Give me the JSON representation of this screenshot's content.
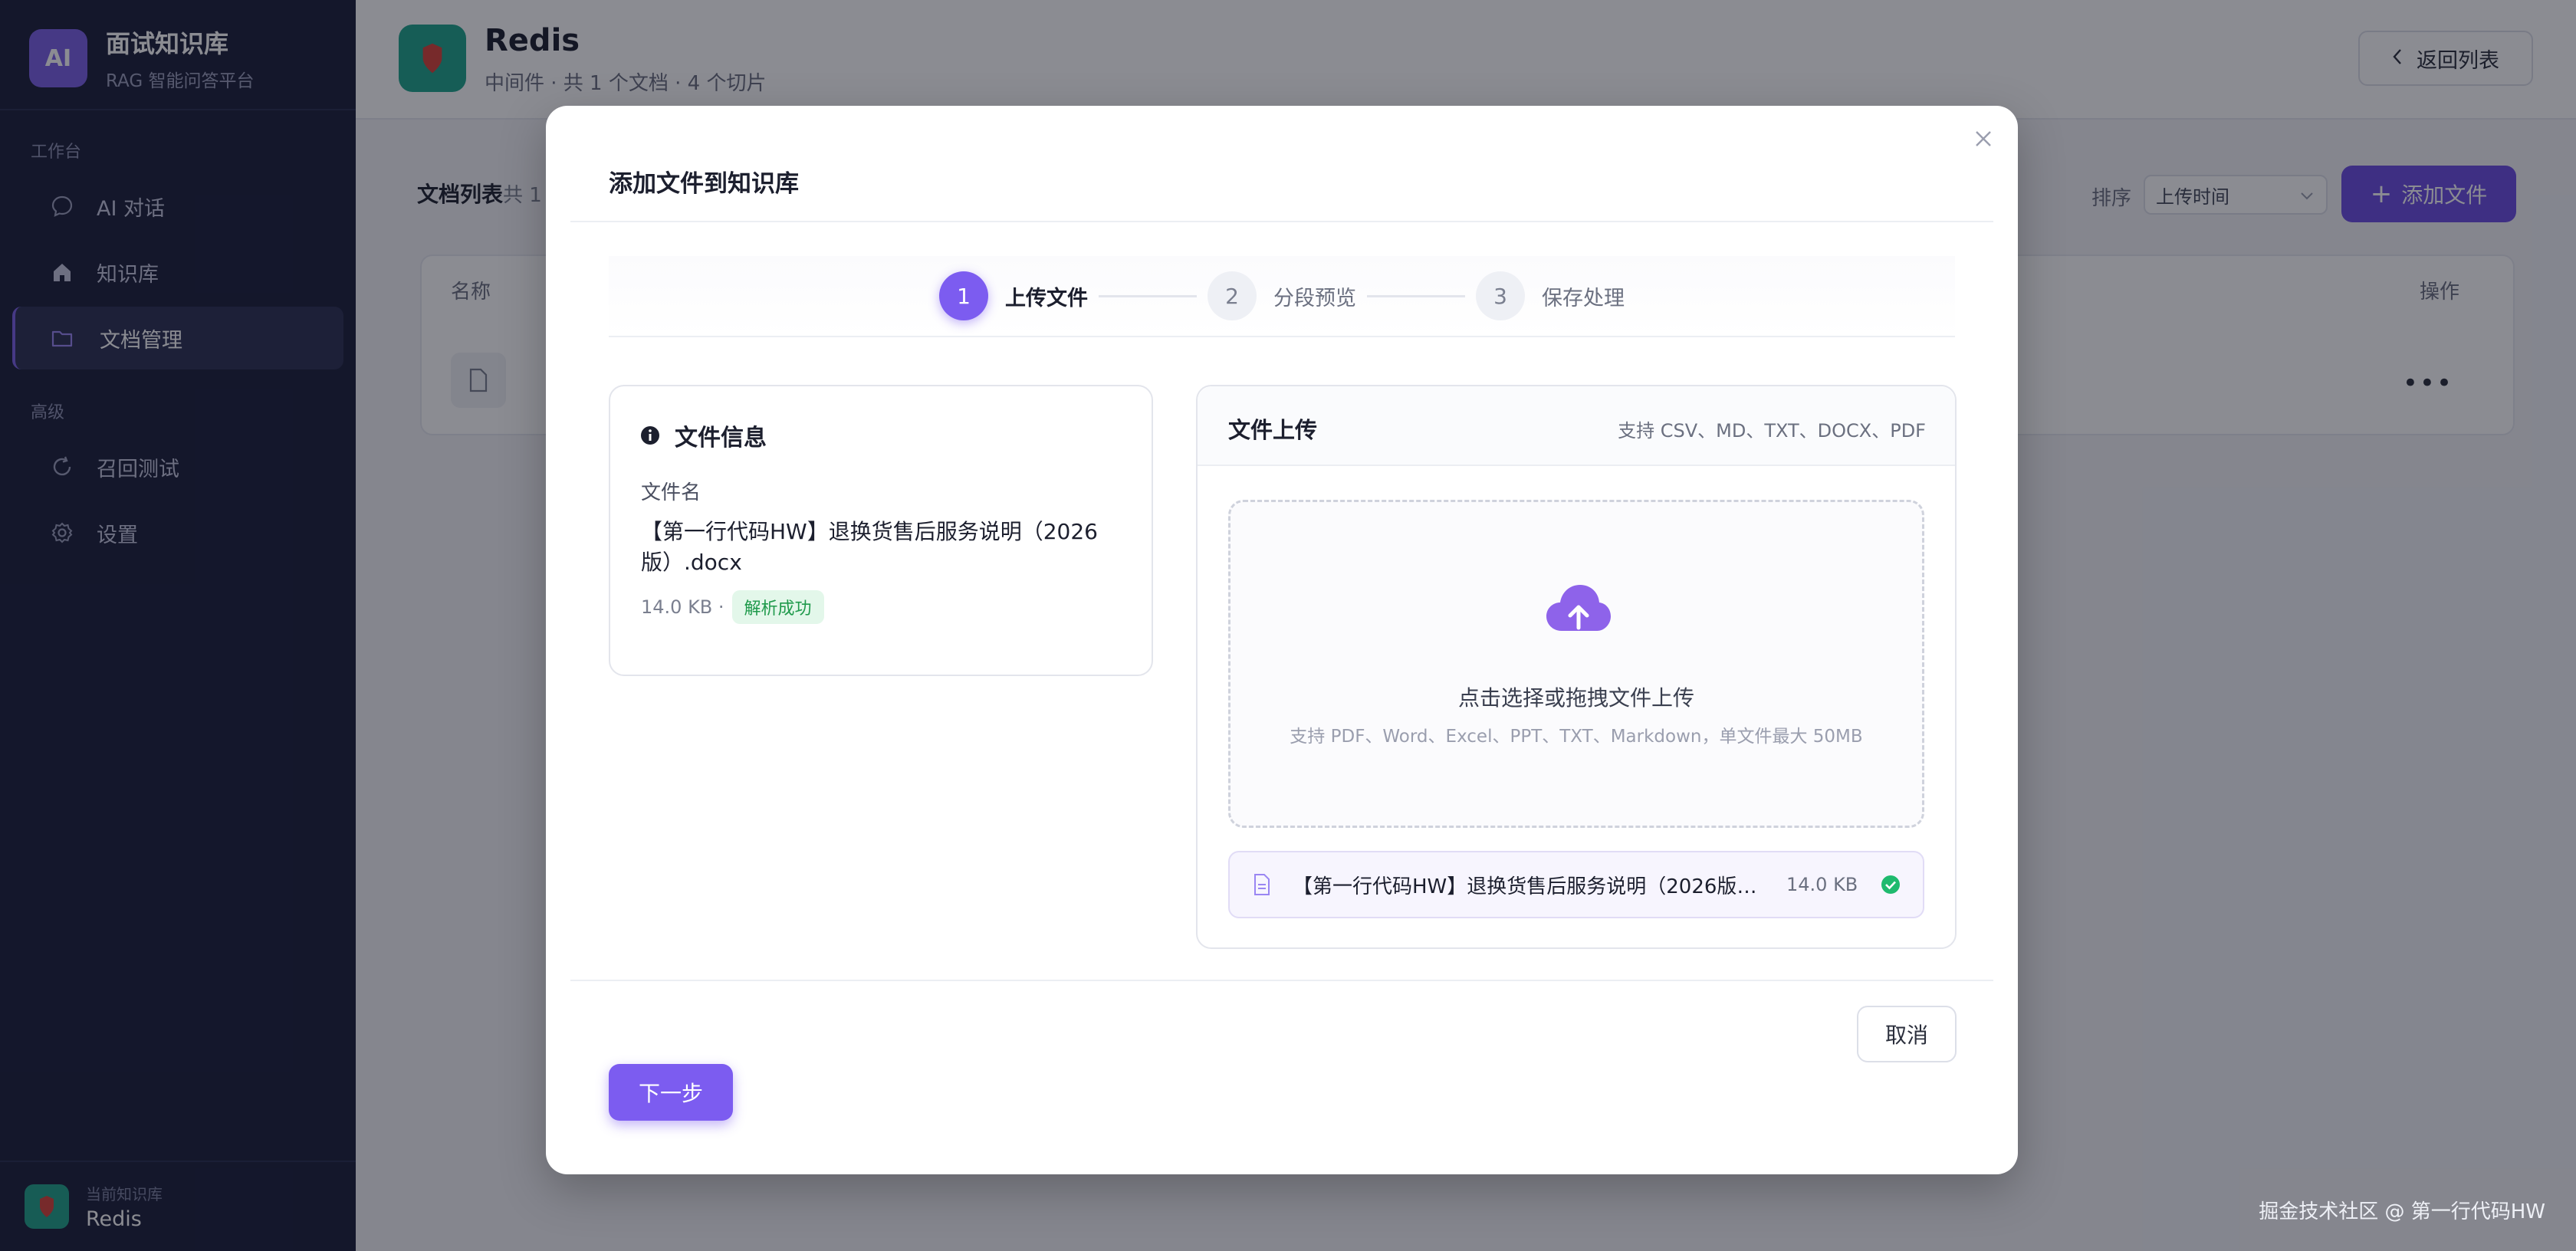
{
  "sidebar": {
    "brand": {
      "logo": "AI",
      "title": "面试知识库",
      "subtitle": "RAG 智能问答平台"
    },
    "groups": [
      {
        "label": "工作台",
        "items": [
          {
            "label": "AI 对话",
            "icon": "chat-icon"
          },
          {
            "label": "知识库",
            "icon": "home-icon"
          },
          {
            "label": "文档管理",
            "icon": "folder-icon",
            "active": true
          }
        ]
      },
      {
        "label": "高级",
        "items": [
          {
            "label": "召回测试",
            "icon": "refresh-icon"
          },
          {
            "label": "设置",
            "icon": "gear-icon"
          }
        ]
      }
    ],
    "footer": {
      "label": "当前知识库",
      "value": "Redis"
    }
  },
  "header": {
    "title": "Redis",
    "meta": "中间件 · 共 1 个文档 · 4 个切片",
    "back_label": "返回列表"
  },
  "list": {
    "title": "文档列表",
    "count": "共 1",
    "sort_label": "排序",
    "sort_value": "上传时间",
    "add_label": "添加文件",
    "col_name": "名称",
    "col_ops": "操作"
  },
  "modal": {
    "title": "添加文件到知识库",
    "steps": [
      {
        "num": "1",
        "label": "上传文件",
        "active": true
      },
      {
        "num": "2",
        "label": "分段预览"
      },
      {
        "num": "3",
        "label": "保存处理"
      }
    ],
    "info": {
      "title": "文件信息",
      "name_label": "文件名",
      "file_name": "【第一行代码HW】退换货售后服务说明（2026版）.docx",
      "size": "14.0 KB ·",
      "status": "解析成功"
    },
    "upload": {
      "title": "文件上传",
      "formats": "支持 CSV、MD、TXT、DOCX、PDF",
      "drop_main": "点击选择或拖拽文件上传",
      "drop_sub": "支持 PDF、Word、Excel、PPT、TXT、Markdown，单文件最大 50MB",
      "file_name": "【第一行代码HW】退换货售后服务说明（2026版）...",
      "file_size": "14.0 KB"
    },
    "cancel_label": "取消",
    "next_label": "下一步"
  },
  "watermark": "掘金技术社区 @ 第一行代码HW",
  "colors": {
    "accent": "#7c5cf0",
    "sidebar_bg": "#1c1f3b",
    "success": "#1f9a4b",
    "repo_logo": "#1fa58c"
  }
}
